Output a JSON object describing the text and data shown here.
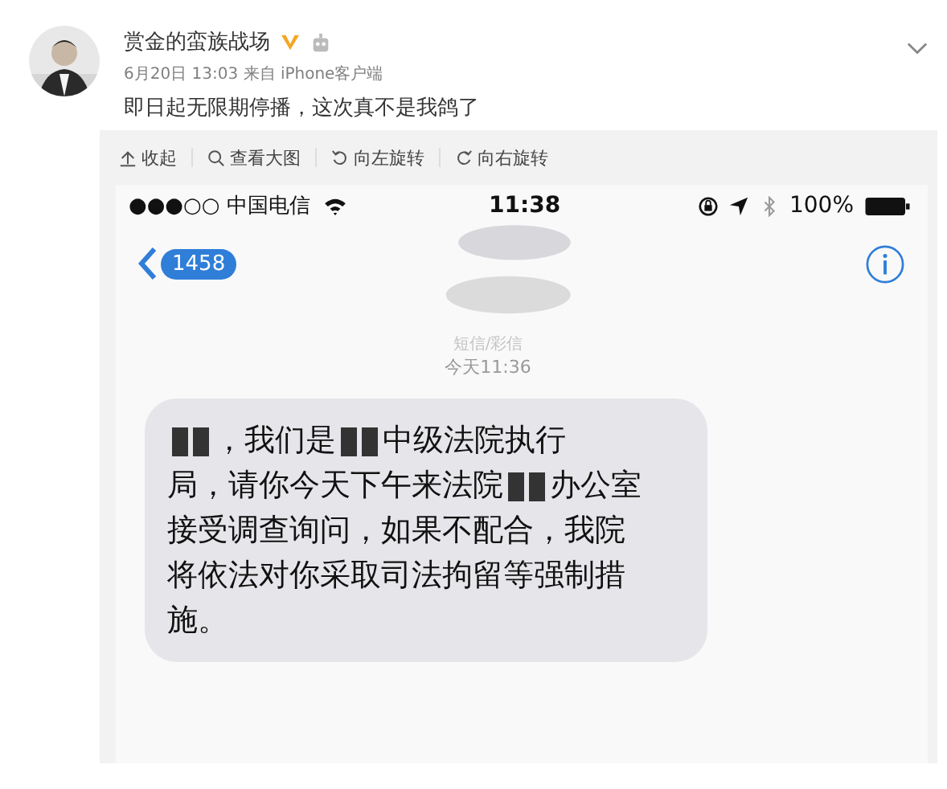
{
  "post": {
    "author": "赏金的蛮族战场",
    "verified": true,
    "meta": "6月20日 13:03 来自 iPhone客户端",
    "text": "即日起无限期停播，这次真不是我鸽了"
  },
  "image_toolbar": [
    {
      "kind": "collapse",
      "label": "收起"
    },
    {
      "kind": "zoom",
      "label": "查看大图"
    },
    {
      "kind": "rotate_left",
      "label": "向左旋转"
    },
    {
      "kind": "rotate_right",
      "label": "向右旋转"
    }
  ],
  "phone": {
    "status_bar": {
      "carrier": "●●●○○ 中国电信",
      "time": "11:38",
      "battery": "100%"
    },
    "contact_badge": "1458",
    "message_label": "短信/彩信",
    "message_time": "今天11:36",
    "message_lines": [
      [
        {
          "kind": "redacted"
        },
        {
          "kind": "text",
          "text": "，我们是"
        },
        {
          "kind": "redacted"
        },
        {
          "kind": "text",
          "text": "中级法院执行"
        }
      ],
      [
        {
          "kind": "text",
          "text": "局，请你今天下午来法院"
        },
        {
          "kind": "redacted"
        },
        {
          "kind": "text",
          "text": "办公室"
        }
      ],
      [
        {
          "kind": "text",
          "text": "接受调查询问，如果不配合，我院"
        }
      ],
      [
        {
          "kind": "text",
          "text": "将依法对你采取司法拘留等强制措"
        }
      ],
      [
        {
          "kind": "text",
          "text": "施。"
        }
      ]
    ]
  }
}
